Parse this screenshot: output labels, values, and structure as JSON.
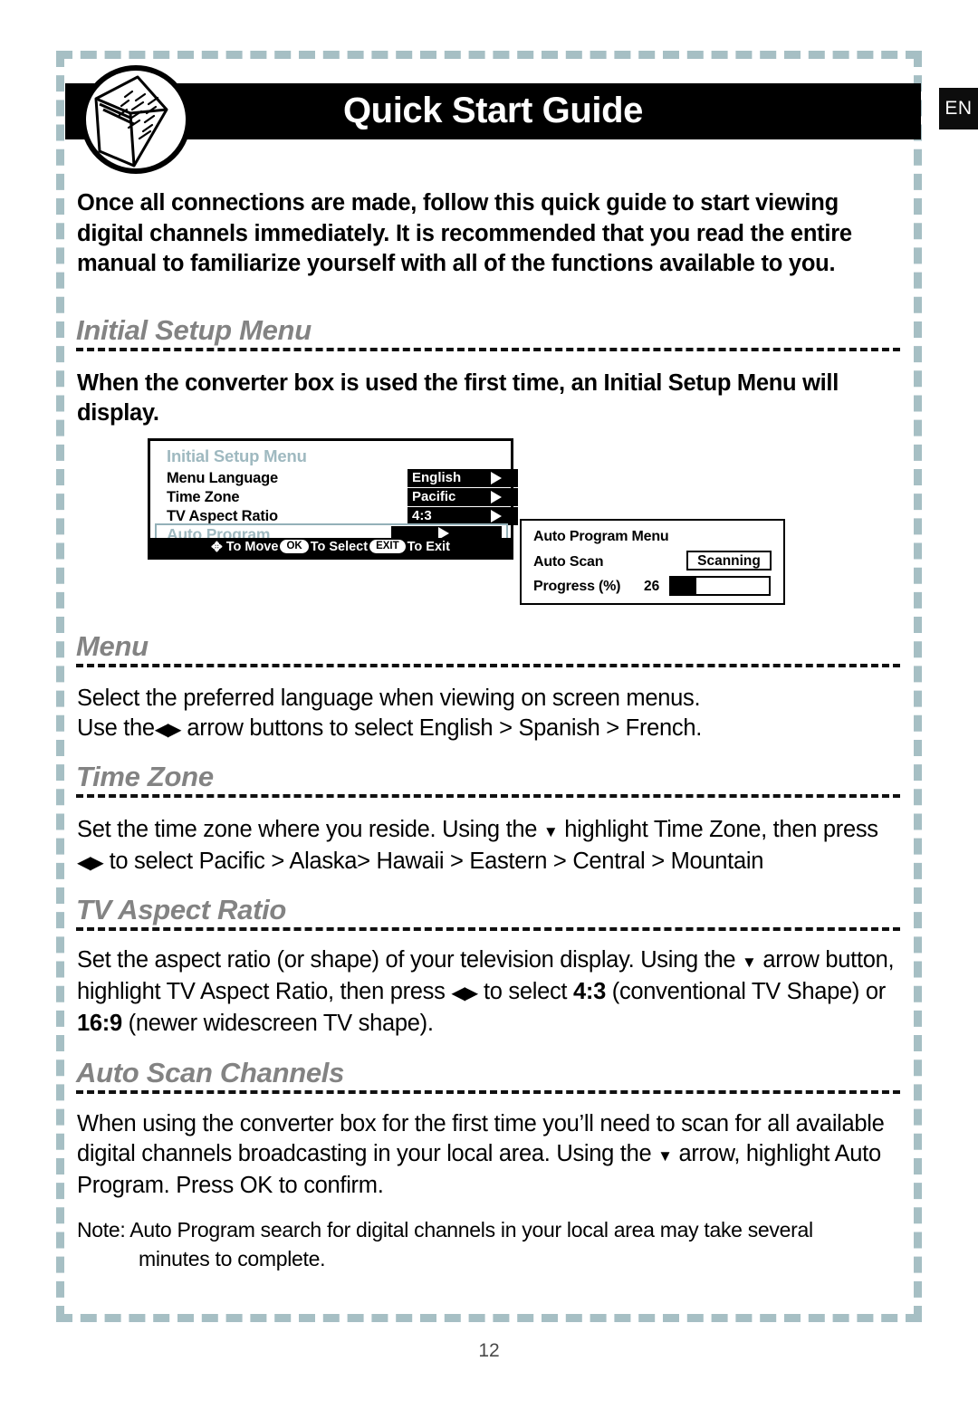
{
  "header": {
    "title": "Quick Start Guide",
    "language_tag": "EN",
    "book_icon": "open-book-icon"
  },
  "intro": "Once all connections are made, follow this quick guide to start viewing digital channels immediately. It is recommended that you read the entire manual to familiarize yourself with all of the functions available to you.",
  "sections": [
    {
      "heading": "Initial Setup Menu",
      "body": "When the converter box is used the first time, an Initial Setup Menu will display."
    },
    {
      "heading": "Menu",
      "body_line1": "Select the preferred language when viewing on screen menus.",
      "body_line2_pre": "Use the",
      "body_line2_post": "arrow buttons to select English > Spanish > French."
    },
    {
      "heading": "Time Zone",
      "body_pre": "Set the time zone where you reside. Using the",
      "body_mid": "highlight Time Zone, then press",
      "body_post": "to select Pacific > Alaska> Hawaii > Eastern > Central > Mountain"
    },
    {
      "heading": "TV Aspect Ratio",
      "body_pre": "Set the aspect ratio (or shape) of your television display. Using the",
      "body_mid": "arrow button, highlight TV Aspect Ratio, then press",
      "body_post": "to select",
      "ratio_1": "4:3",
      "body_post2": "(conventional TV Shape) or",
      "ratio_2": "16:9",
      "body_post3": "(newer widescreen TV shape)."
    },
    {
      "heading": "Auto Scan Channels",
      "body_pre": "When using the converter box for the first time you’ll need to scan for all available digital channels broadcasting in your local area. Using the",
      "body_post": "arrow, highlight Auto Program. Press OK to confirm."
    }
  ],
  "note": {
    "line1": "Note: Auto Program search for digital channels in your local area may take several",
    "line2": "minutes to complete."
  },
  "osd_setup_menu": {
    "title": "Initial Setup Menu",
    "rows": [
      {
        "label": "Menu Language",
        "value": "English"
      },
      {
        "label": "Time Zone",
        "value": "Pacific"
      },
      {
        "label": "TV Aspect Ratio",
        "value": "4:3"
      }
    ],
    "highlighted_row": {
      "label": "Auto Program",
      "value": ""
    },
    "hint": {
      "move_glyph": "✥",
      "move_text": "To Move",
      "ok_key": "OK",
      "select_text": "To Select",
      "exit_key": "EXIT",
      "exit_text": "To Exit"
    }
  },
  "osd_auto_program": {
    "title": "Auto Program Menu",
    "scan_label": "Auto Scan",
    "scan_status": "Scanning",
    "progress_label": "Progress (%)",
    "progress_value": "26",
    "progress_percent": 26
  },
  "page_number": "12",
  "colors": {
    "frame_dash": "#a6bfc4",
    "heading_gray": "#838383",
    "osd_accent": "#9fb9c0",
    "bar_black": "#000000"
  }
}
